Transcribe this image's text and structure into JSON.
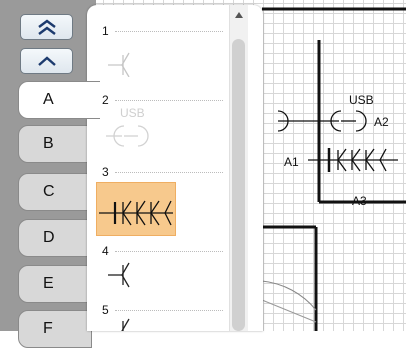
{
  "diagram": {
    "labels": {
      "usb": "USB",
      "a2": "A2",
      "a1": "A1",
      "a3": "A3"
    }
  },
  "rail": {
    "scroll_top_icon": "double-chevron-up-icon",
    "scroll_up_icon": "chevron-up-icon",
    "tabs": [
      {
        "label": "A",
        "active": true
      },
      {
        "label": "B",
        "active": false
      },
      {
        "label": "C",
        "active": false
      },
      {
        "label": "D",
        "active": false
      },
      {
        "label": "E",
        "active": false
      },
      {
        "label": "F",
        "active": false
      }
    ]
  },
  "palette": {
    "items": [
      {
        "number": "1",
        "symbol": "single-contact-symbol",
        "state": "normal"
      },
      {
        "number": "2",
        "symbol": "usb-connector-symbol",
        "label": "USB",
        "state": "disabled"
      },
      {
        "number": "3",
        "symbol": "triple-contact-symbol",
        "state": "selected"
      },
      {
        "number": "4",
        "symbol": "single-contact-symbol",
        "state": "normal"
      },
      {
        "number": "5",
        "symbol": "single-contact-symbol",
        "state": "normal"
      }
    ],
    "selected_color": "#f7c98d"
  }
}
